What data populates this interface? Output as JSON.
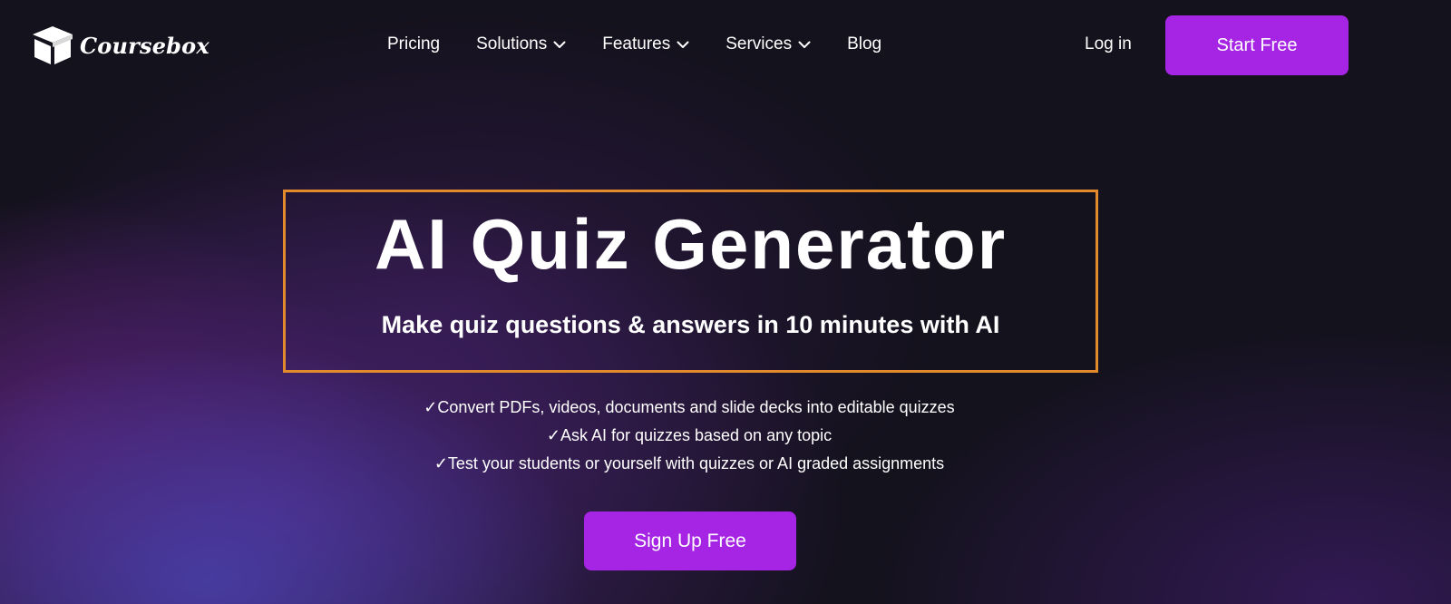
{
  "header": {
    "brand": "Coursebox",
    "nav": [
      {
        "label": "Pricing",
        "has_dropdown": false,
        "icon": ""
      },
      {
        "label": "Solutions",
        "has_dropdown": true,
        "icon": "chevron-down-icon"
      },
      {
        "label": "Features",
        "has_dropdown": true,
        "icon": "chevron-down-icon"
      },
      {
        "label": "Services",
        "has_dropdown": true,
        "icon": "chevron-down-icon"
      },
      {
        "label": "Blog",
        "has_dropdown": false,
        "icon": ""
      }
    ],
    "login_label": "Log in",
    "start_label": "Start Free"
  },
  "hero": {
    "title": "AI Quiz Generator",
    "subtitle": "Make quiz questions & answers in 10 minutes with AI",
    "features": [
      "✓Convert PDFs, videos, documents and slide decks into editable quizzes",
      "✓Ask AI for quizzes based on any topic",
      "✓Test your students or yourself with quizzes or AI graded assignments"
    ],
    "cta_label": "Sign Up Free"
  },
  "colors": {
    "background": "#14121d",
    "accent": "#a624e3",
    "highlight_border": "#e38b2c"
  }
}
